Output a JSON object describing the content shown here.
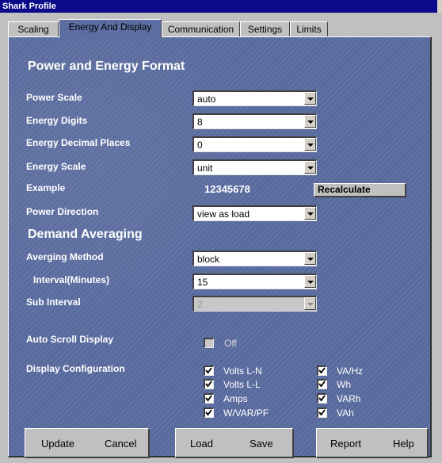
{
  "window": {
    "title": "Shark Profile"
  },
  "tabs": [
    {
      "label": "Scaling"
    },
    {
      "label": "Energy And Display"
    },
    {
      "label": "Communication"
    },
    {
      "label": "Settings"
    },
    {
      "label": "Limits"
    }
  ],
  "power_energy": {
    "heading": "Power and Energy Format",
    "power_scale": {
      "label": "Power Scale",
      "value": "auto"
    },
    "energy_digits": {
      "label": "Energy Digits",
      "value": "8"
    },
    "energy_decimal": {
      "label": "Energy Decimal Places",
      "value": "0"
    },
    "energy_scale": {
      "label": "Energy Scale",
      "value": "unit"
    },
    "example": {
      "label": "Example",
      "value": "12345678",
      "button": "Recalculate"
    },
    "power_direction": {
      "label": "Power Direction",
      "value": "view as load"
    }
  },
  "demand": {
    "heading": "Demand Averaging",
    "method": {
      "label": "Averging Method",
      "value": "block"
    },
    "interval": {
      "label": "Interval(Minutes)",
      "value": "15"
    },
    "sub_interval": {
      "label": "Sub Interval",
      "value": "2"
    }
  },
  "auto_scroll": {
    "label": "Auto Scroll Display",
    "checked": false,
    "text": "Off"
  },
  "display_config": {
    "label": "Display Configuration",
    "col1": [
      {
        "label": "Volts L-N",
        "checked": true
      },
      {
        "label": "Volts L-L",
        "checked": true
      },
      {
        "label": "Amps",
        "checked": true
      },
      {
        "label": "W/VAR/PF",
        "checked": true
      }
    ],
    "col2": [
      {
        "label": "VA/Hz",
        "checked": true
      },
      {
        "label": "Wh",
        "checked": true
      },
      {
        "label": "VARh",
        "checked": true
      },
      {
        "label": "VAh",
        "checked": true
      }
    ]
  },
  "buttons": {
    "update": "Update",
    "cancel": "Cancel",
    "load": "Load",
    "save": "Save",
    "report": "Report",
    "help": "Help"
  },
  "colors": {
    "panel": "#5b6da1",
    "titlebar": "#0a0a8a",
    "chrome": "#c0c0c0"
  }
}
